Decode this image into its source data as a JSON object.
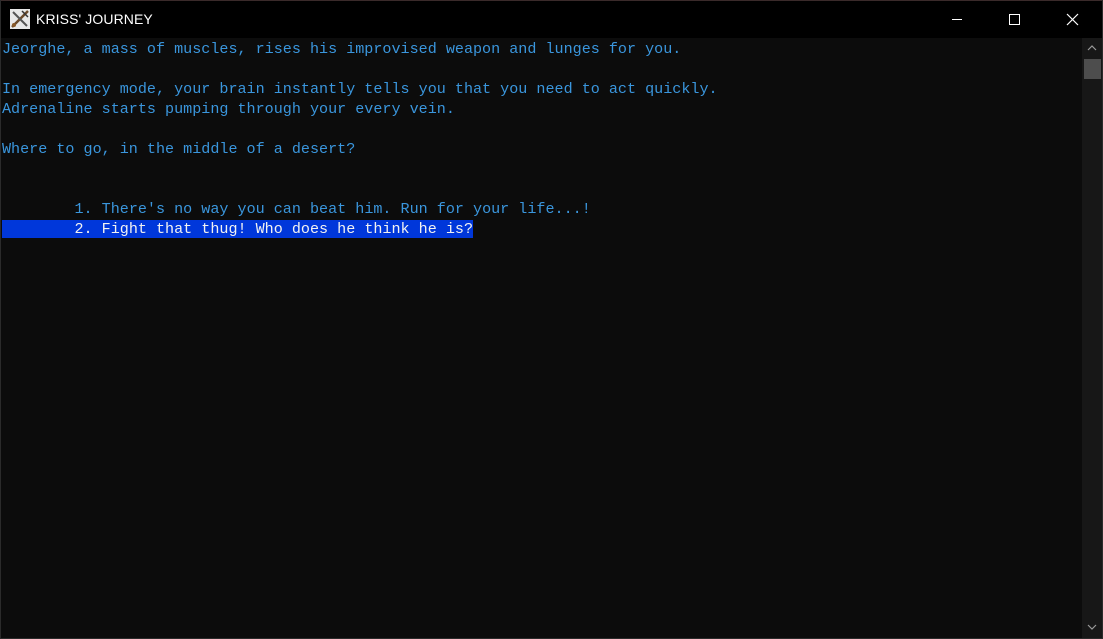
{
  "window": {
    "title": "KRISS' JOURNEY",
    "icon": "crossed-swords-icon"
  },
  "controls": {
    "minimize_icon": "minimize-icon",
    "maximize_icon": "maximize-icon",
    "close_icon": "close-icon"
  },
  "console": {
    "text_color": "#3a96dd",
    "highlight_bg": "#0037da",
    "lines": {
      "l1": "Jeorghe, a mass of muscles, rises his improvised weapon and lunges for you.",
      "l2": "In emergency mode, your brain instantly tells you that you need to act quickly.",
      "l3": "Adrenaline starts pumping through your every vein.",
      "l4": "Where to go, in the middle of a desert?"
    },
    "options": [
      {
        "prefix": "        ",
        "text": "1. There's no way you can beat him. Run for your life...!",
        "selected": false
      },
      {
        "prefix": "        ",
        "text": "2. Fight that thug! Who does he think he is?",
        "selected": true
      }
    ]
  }
}
